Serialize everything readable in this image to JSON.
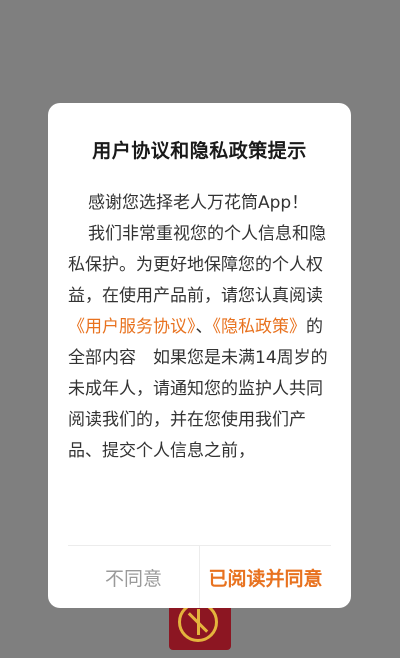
{
  "dialog": {
    "title": "用户协议和隐私政策提示",
    "para1": "感谢您选择老人万花筒App！",
    "para2_intro": "我们非常重视您的个人信息和隐私保护。为更好地保障您的个人权益，在使用产品前，请您认真阅读",
    "user_agreement_link": "《用户服务协议》",
    "separator": "、",
    "privacy_policy_link": "《隐私政策》",
    "para2_outro": "的全部内容　如果您是未满14周岁的未成年人，请通知您的监护人共同阅读我们的，并在您使用我们产品、提交个人信息之前，",
    "disagree_label": "不同意",
    "agree_label": "已阅读并同意"
  },
  "colors": {
    "overlay": "#7f7f7f",
    "accent": "#e8721f",
    "dialog_bg": "#ffffff"
  },
  "icons": {
    "app_icon": "app-logo-icon"
  }
}
